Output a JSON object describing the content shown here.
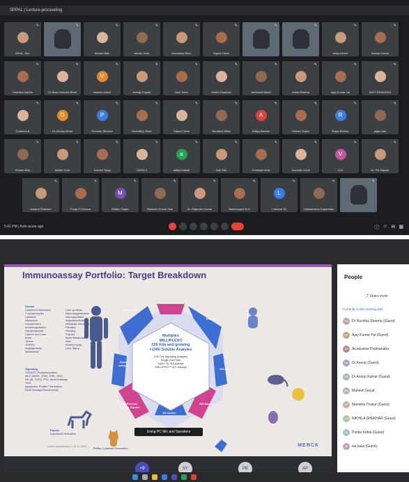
{
  "meet": {
    "window_title": "SPPAL | Lecture-proceeding",
    "time_text": "5:41 PM  |  Auto-acute ago",
    "participants_row1": [
      "Eff'ciL, Sub",
      "",
      "Sonam Bidh",
      "Ashish Dora",
      "Anandkey Rave",
      "Sapna Tribar",
      "",
      "",
      "srivpunit.bol",
      "Sachin Kumar"
    ],
    "participants_row2": [
      "Hiranshu kainde",
      "Dr Bhan chandra Bhatt",
      "shvaniz.anmol",
      "Anirajy Pujpari",
      "Ravi Sobe",
      "Surbhi Chauhan",
      "Abhinand Bhatti",
      "Alivia Sharma",
      "Ajay Kumar Lal",
      "KRITI REHOGRA"
    ],
    "participants_row3": [
      "Dodesha A",
      "Dr Jimcan Mhan",
      "Punnam Sharma",
      "Anandkey Rave",
      "Sapna Tribar",
      "Bandana Mitra",
      "Aditya Ashane",
      "Kishori Gupta",
      "Rajan Mathur",
      "jagat.mari"
    ],
    "participants_row4": [
      "Sonam Bidh",
      "Ashish Dora",
      "Sukesh Tyagi",
      "CDFM.3",
      "aditya.bubnik",
      "Anil Sidi",
      "Christuja Hess",
      "Kanchan Kohli",
      "ICS",
      "Dr. PD Majoob"
    ],
    "participants_row5": [
      "Ankana Shansen",
      "Pooja D Krishna",
      "Madhu Gupta",
      "Raskesh Kumar Sah",
      "Dr. Rajender Kumar",
      "Bashmuqshi M S",
      "Lakshmi TA",
      "Gaitasewsha Dupanthan",
      ""
    ],
    "avatar_letters": {
      "r2c3": "V",
      "r3c2": "D",
      "r3c3": "P",
      "r3c7": "A",
      "r3c9": "R",
      "r4c5": "a",
      "r4c9": "V",
      "r5c3": "M",
      "r5c7": "L"
    }
  },
  "slide": {
    "title": "Immunoassay Portfolio: Target Breakdown",
    "center_lines": [
      "Multiplex",
      "MILLIPLEX®",
      "226 Kits and growing",
      ">1300 Soluble Analytes"
    ],
    "center_sub": [
      "128 Cell Signaling Analytes",
      "Single Dot Point",
      "1800+ ELISA Assays",
      "SMCxPRO™ 30+ Assays"
    ],
    "segments": [
      "836 Human",
      "Primate",
      "182 Rat",
      "236 Mouse",
      "65 Canine",
      "69 Porcine, Feline, Equine",
      "Extra cellular"
    ],
    "left_header": "Human",
    "left_items": [
      "Cytokine/Chemokine",
      "T Lymphocytes",
      "Cytokine",
      "Receptors",
      "Complement",
      "Immunoglobulins",
      "Cardiovascular",
      "Cancer and Liver",
      "Bone",
      "Toxins",
      "SGRPs",
      "Angiogenesis",
      "Metabolism"
    ],
    "left_items2": [
      "Liver proteins",
      "Neurodegenerative",
      "Neuropeptides",
      "Adipokine/Adipose",
      "Metabolic Hormone",
      "Pituitary",
      "Pituitary",
      "Thyroid",
      "Bone Metabolism",
      "Skin",
      "Kidney Injury",
      "Liver Injury"
    ],
    "signaling_header": "Signaling",
    "signaling_items": [
      "TGFβ/ST Phosphorylation",
      "AKT, MAPK, STAT, GPK, GRC",
      "NF-κB, TGFβ, PTK, Multi-Pathway",
      "TCR",
      "Apoptosis, Protein Translation",
      "DNA Damage/Genotoxicity"
    ],
    "equine_label": "Equine",
    "equine_sub": "Cytokine/Chemokine",
    "feline_label": "Feline",
    "feline_sub": "Cytokine/Chemokine",
    "caption": "Using PC Mic and Speakers",
    "footer": "Under construction | 13.11.2023",
    "brand": "MERCK"
  },
  "people_panel": {
    "title": "People",
    "share_label": "Share invite",
    "in_meeting": "Currently in this meeting (55)",
    "rows": [
      {
        "initials": "DS",
        "name": "Dr Ruchika Sharma (Guest)",
        "color": "#b9a6a6"
      },
      {
        "initials": "AP",
        "name": "Ajay Kumar Pal (Guest)",
        "color": "#c9a680"
      },
      {
        "initials": "AP",
        "name": "Arunkumar Padmanabu",
        "color": "#b08b8b"
      },
      {
        "initials": "DA",
        "name": "Dr Anoop (Guest)",
        "color": "#a3a3c2"
      },
      {
        "initials": "DA",
        "name": "Dr Anoop Kumar (Guest)",
        "color": "#a3b8c2"
      },
      {
        "initials": "MG",
        "name": "Mahesh Goyal",
        "color": "#b5b5b5"
      },
      {
        "initials": "MT",
        "name": "Manisha Thakur (Guest)",
        "color": "#c2b0a3"
      },
      {
        "initials": "NS",
        "name": "NIKHILA SHEKHAR (Guest)",
        "color": "#b0c2a3"
      },
      {
        "initials": "PK",
        "name": "Punita Kohla (Guest)",
        "color": "#a3c2c2"
      },
      {
        "initials": "SK",
        "name": "sia kalai (Guest)",
        "color": "#c2a3b8"
      }
    ]
  },
  "meeting_bar": {
    "avatars": [
      "+9",
      "SY",
      "PB",
      "AP"
    ]
  },
  "colors": {
    "accent": "#4b3a8a",
    "hex_blue": "#3f6ed3",
    "hex_pink": "#d1438f",
    "end_call": "#e5443a"
  }
}
